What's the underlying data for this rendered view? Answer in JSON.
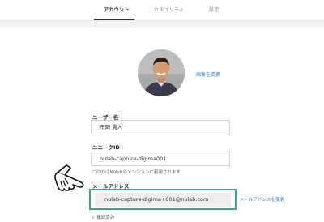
{
  "tabs": [
    {
      "label": "アカウント",
      "active": true
    },
    {
      "label": "セキュリティ",
      "active": false
    },
    {
      "label": "設定",
      "active": false
    }
  ],
  "profile": {
    "change_photo_label": "画像を変更"
  },
  "username": {
    "label": "ユーザー名",
    "value": "市岡 貫人"
  },
  "unique_id": {
    "label": "ユニークID",
    "value": "nulab-capture-digima001",
    "hint": "このIDはNulabのメンションに利用されます"
  },
  "email": {
    "label": "メールアドレス",
    "value": "nulab-capture-digima+001@nulab.com",
    "change_label": "メールアドレスを変更",
    "verified_label": "✓ 確認済み"
  },
  "colors": {
    "highlight_border": "#3da68a",
    "link": "#2f7bb5"
  }
}
